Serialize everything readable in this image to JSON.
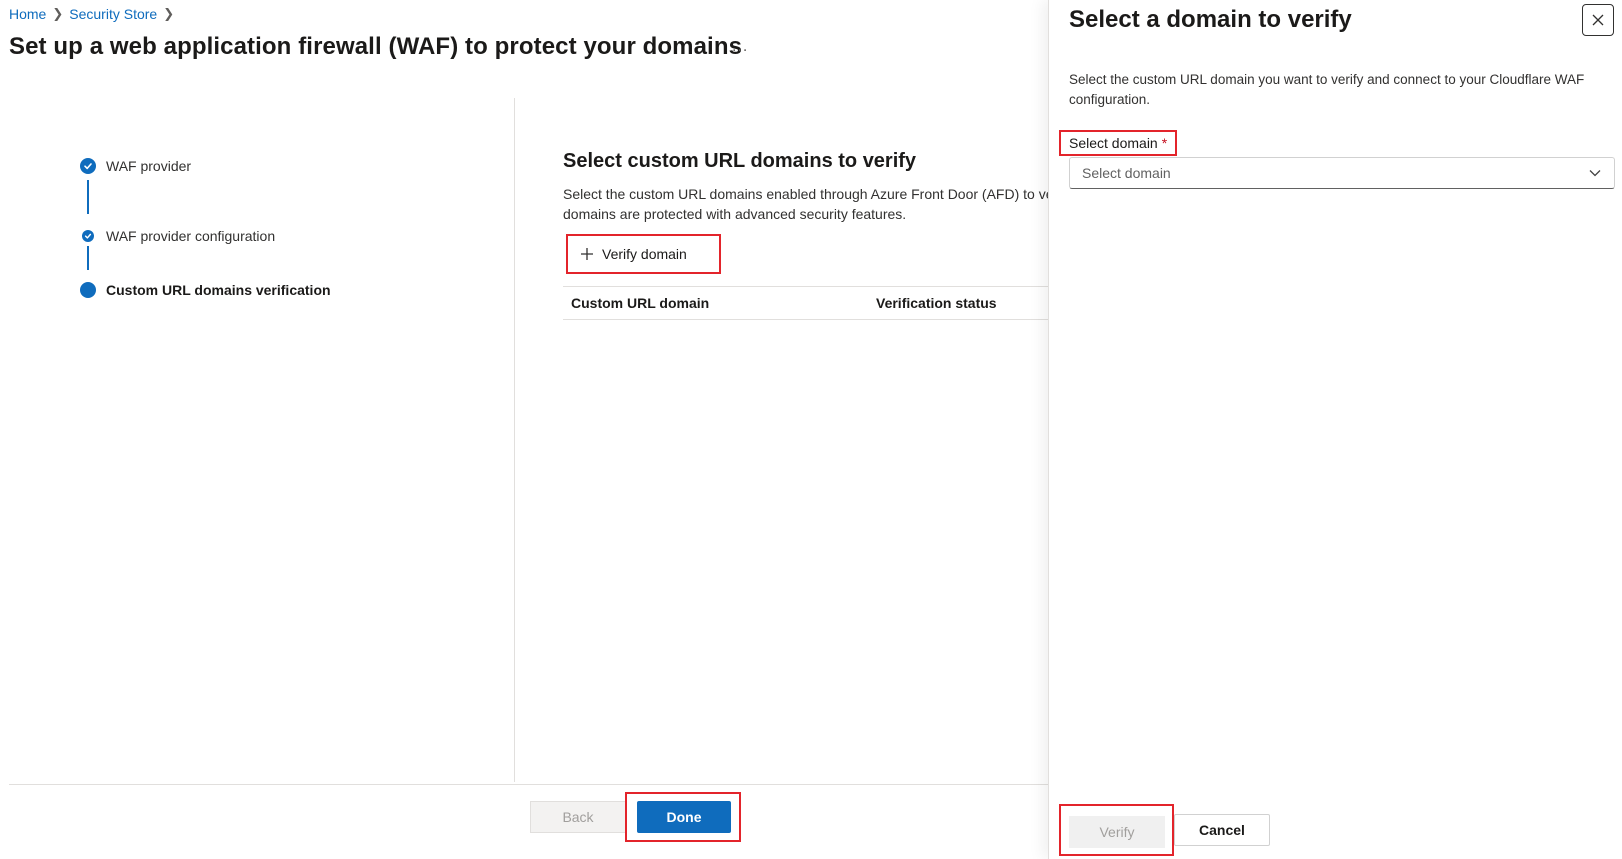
{
  "breadcrumb": {
    "items": [
      "Home",
      "Security Store"
    ]
  },
  "page": {
    "title": "Set up a web application firewall (WAF) to protect your domains",
    "more_label": "..."
  },
  "stepper": {
    "steps": [
      {
        "label": "WAF provider",
        "state": "completed"
      },
      {
        "label": "WAF provider configuration",
        "state": "completed"
      },
      {
        "label": "Custom URL domains verification",
        "state": "active"
      }
    ]
  },
  "main": {
    "section_title": "Select custom URL domains to verify",
    "description_line1": "Select the custom URL domains enabled through Azure Front Door (AFD) to ve",
    "description_line2": "domains are protected with advanced security features.",
    "verify_domain_label": "Verify domain",
    "table": {
      "columns": [
        "Custom URL domain",
        "Verification status"
      ],
      "rows": []
    }
  },
  "footer": {
    "back_label": "Back",
    "done_label": "Done"
  },
  "panel": {
    "title": "Select a domain to verify",
    "description": "Select the custom URL domain you want to verify and connect to your Cloudflare WAF configuration.",
    "field_label": "Select domain",
    "required_mark": "*",
    "select_placeholder": "Select domain",
    "verify_label": "Verify",
    "cancel_label": "Cancel"
  },
  "colors": {
    "accent": "#0f6cbd",
    "highlight": "#e3242b",
    "required": "#c50f1f"
  },
  "icons": {
    "check": "checkmark-icon",
    "plus": "plus-icon",
    "close": "close-icon",
    "chevron": "chevron-down-icon"
  }
}
